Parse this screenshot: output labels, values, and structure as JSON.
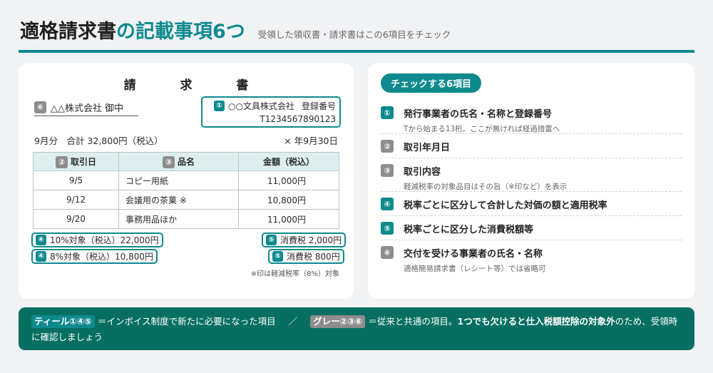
{
  "header": {
    "title_main": "適格請求書",
    "title_accent": "の記載事項6つ",
    "subtitle": "受領した領収書・請求書はこの6項目をチェック"
  },
  "invoice": {
    "title": "請 求 書",
    "recipient": {
      "num": "⑥",
      "name": "△△株式会社 御中"
    },
    "issuer": {
      "num": "①",
      "name": "○○文具株式会社",
      "reg_label": "登録番号",
      "reg_no": "T1234567890123"
    },
    "summary": "9月分　合計 32,800円（税込）",
    "due": "× 年9月30日",
    "columns": [
      {
        "num": "②",
        "label": "取引日"
      },
      {
        "num": "③",
        "label": "品名"
      },
      {
        "num": "",
        "label": "金額（税込）"
      }
    ],
    "rows": [
      {
        "date": "9/5",
        "item": "コピー用紙",
        "amount": "11,000円"
      },
      {
        "date": "9/12",
        "item": "会議用の茶菓 ※",
        "amount": "10,800円"
      },
      {
        "date": "9/20",
        "item": "事務用品ほか",
        "amount": "11,000円"
      }
    ],
    "subtotal_10": {
      "num": "④",
      "text": "10%対象（税込）22,000円"
    },
    "subtotal_8": {
      "num": "④",
      "text": "8%対象（税込）10,800円"
    },
    "tax_10": {
      "num": "⑤",
      "text": "消費税 2,000円"
    },
    "tax_8": {
      "num": "⑤",
      "text": "消費税 800円"
    },
    "note": "※印は軽減税率（8%）対象"
  },
  "checklist": {
    "heading": "チェックする6項目",
    "items": [
      {
        "num": "①",
        "label": "発行事業者の氏名・名称と登録番号",
        "sub": "Tから始まる13桁。ここが無ければ経過措置へ"
      },
      {
        "num": "②",
        "label": "取引年月日",
        "sub": ""
      },
      {
        "num": "③",
        "label": "取引内容",
        "sub": "軽減税率の対象品目はその旨（※印など）を表示"
      },
      {
        "num": "④",
        "label": "税率ごとに区分して合計した対価の額と適用税率",
        "sub": ""
      },
      {
        "num": "⑤",
        "label": "税率ごとに区分した消費税額等",
        "sub": ""
      },
      {
        "num": "⑥",
        "label": "交付を受ける事業者の氏名・名称",
        "sub": "適格簡易請求書（レシート等）では省略可"
      }
    ]
  },
  "footer": {
    "teal_tag": "ティール①④⑤",
    "teal_text": "＝インボイス制度で新たに必要になった項目",
    "separator": "／",
    "gray_tag": "グレー②③⑥",
    "gray_text": "＝従来と共通の項目。",
    "emphasis": "1つでも欠けると仕入税額控除の対象外",
    "tail": "のため、受領時に確認しましょう"
  },
  "colors": {
    "accent": "#0e8a8e",
    "neutral": "#8d8d8d",
    "footer_bg": "#076f62"
  }
}
